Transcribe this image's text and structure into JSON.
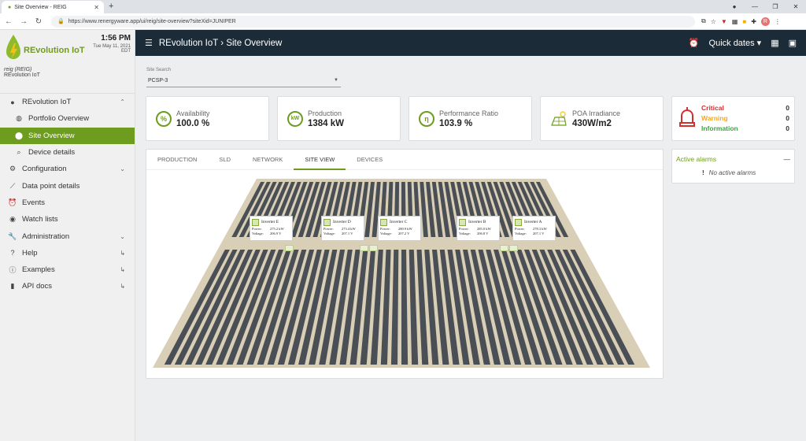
{
  "browser": {
    "tab_title": "Site Overview - REIG",
    "url": "https://www.renergyware.app/ui/reig/site-overview?siteXid=JUNIPER",
    "profile_initial": "R"
  },
  "sidebar": {
    "brand": "REvolution IoT",
    "time": "1:56 PM",
    "date": "Tue May 11, 2021",
    "tz": "EDT",
    "user_line1": "reig (REIG)",
    "user_line2": "REvolution IoT",
    "items": [
      {
        "label": "REvolution IoT",
        "icon": "dot-icon"
      },
      {
        "label": "Portfolio Overview",
        "icon": "globe-icon"
      },
      {
        "label": "Site Overview",
        "icon": "map-pin-icon"
      },
      {
        "label": "Device details",
        "icon": "search-icon"
      },
      {
        "label": "Configuration",
        "icon": "gear-icon"
      },
      {
        "label": "Data point details",
        "icon": "trend-icon"
      },
      {
        "label": "Events",
        "icon": "alarm-icon"
      },
      {
        "label": "Watch lists",
        "icon": "eye-icon"
      },
      {
        "label": "Administration",
        "icon": "wrench-icon"
      },
      {
        "label": "Help",
        "icon": "help-icon"
      },
      {
        "label": "Examples",
        "icon": "info-icon"
      },
      {
        "label": "API docs",
        "icon": "book-icon"
      }
    ]
  },
  "header": {
    "app": "REvolution IoT",
    "page": "Site Overview",
    "quick_dates": "Quick dates"
  },
  "search": {
    "label": "Site Search",
    "value": "PCSP-3"
  },
  "kpis": [
    {
      "label": "Availability",
      "value": "100.0 %",
      "icon": "%"
    },
    {
      "label": "Production",
      "value": "1384 kW",
      "icon": "kW"
    },
    {
      "label": "Performance Ratio",
      "value": "103.9 %",
      "icon": "η"
    },
    {
      "label": "POA Irradiance",
      "value": "430W/m2",
      "icon": "solar-panel-icon"
    }
  ],
  "alarm_summary": [
    {
      "label": "Critical",
      "count": "0",
      "color": "#d32f2f"
    },
    {
      "label": "Warning",
      "count": "0",
      "color": "#f5a623"
    },
    {
      "label": "Information",
      "count": "0",
      "color": "#43a047"
    }
  ],
  "tabs": [
    "PRODUCTION",
    "SLD",
    "NETWORK",
    "SITE VIEW",
    "DEVICES"
  ],
  "active_alarms": {
    "title": "Active alarms",
    "collapse": "—",
    "empty": "No active alarms",
    "mark": "!"
  },
  "inverters": [
    {
      "name": "Inverter E",
      "power_label": "Power:",
      "power": "275.2 kW",
      "voltage_label": "Voltage:",
      "voltage": "206.9 V"
    },
    {
      "name": "Inverter D",
      "power_label": "Power:",
      "power": "273.4 kW",
      "voltage_label": "Voltage:",
      "voltage": "207.1 V"
    },
    {
      "name": "Inverter C",
      "power_label": "Power:",
      "power": "280.9 kW",
      "voltage_label": "Voltage:",
      "voltage": "207.2 V"
    },
    {
      "name": "Inverter B",
      "power_label": "Power:",
      "power": "285.0 kW",
      "voltage_label": "Voltage:",
      "voltage": "206.8 V"
    },
    {
      "name": "Inverter A",
      "power_label": "Power:",
      "power": "278.3 kW",
      "voltage_label": "Voltage:",
      "voltage": "207.1 V"
    }
  ],
  "colors": {
    "accent": "#6e9c1e",
    "header": "#1b2b37",
    "ground": "#d9ceb6",
    "panel": "#4a4e55"
  }
}
